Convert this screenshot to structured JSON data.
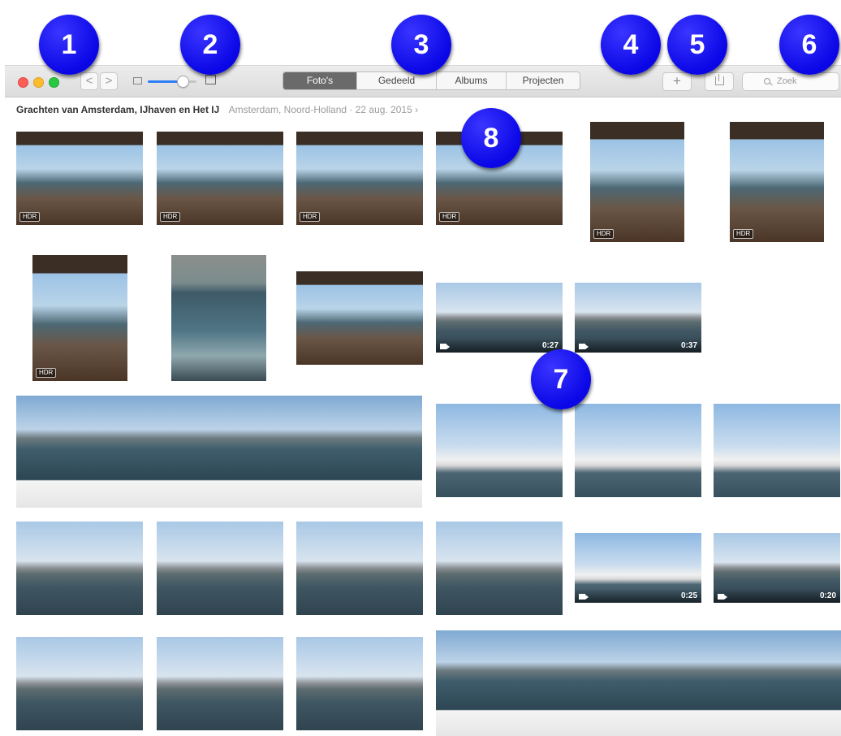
{
  "window": {
    "buttons": [
      "close",
      "minimize",
      "zoom"
    ]
  },
  "nav": {
    "back_label": "<",
    "forward_label": ">"
  },
  "zoom_slider": {
    "level": 0.7
  },
  "tabs": [
    {
      "label": "Foto's",
      "active": true
    },
    {
      "label": "Gedeeld",
      "active": false
    },
    {
      "label": "Albums",
      "active": false
    },
    {
      "label": "Projecten",
      "active": false
    }
  ],
  "toolbar": {
    "add_label": "+",
    "share_icon": "share-icon"
  },
  "search": {
    "placeholder": "Zoek"
  },
  "moment": {
    "title": "Grachten van Amsterdam, IJhaven en Het IJ",
    "meta": "Amsterdam, Noord-Holland · 22 aug. 2015 ›"
  },
  "callouts": [
    "1",
    "2",
    "3",
    "4",
    "5",
    "6",
    "7",
    "8"
  ],
  "photos": [
    {
      "scene": "cabin",
      "badge": "HDR"
    },
    {
      "scene": "cabin",
      "badge": "HDR"
    },
    {
      "scene": "cabin",
      "badge": "HDR"
    },
    {
      "scene": "cabin",
      "badge": "HDR"
    },
    {
      "scene": "cabin",
      "badge": "HDR"
    },
    {
      "scene": "cabin",
      "badge": "HDR"
    },
    {
      "scene": "cabin",
      "badge": "HDR"
    },
    {
      "scene": "wake"
    },
    {
      "scene": "cabin"
    },
    {
      "scene": "harbor",
      "duration": "0:27"
    },
    {
      "scene": "harbor",
      "duration": "0:37"
    },
    {
      "scene": "panorama"
    },
    {
      "scene": "tallship"
    },
    {
      "scene": "tallship"
    },
    {
      "scene": "tallship"
    },
    {
      "scene": "harbor"
    },
    {
      "scene": "harbor"
    },
    {
      "scene": "harbor"
    },
    {
      "scene": "harbor"
    },
    {
      "scene": "tallship",
      "duration": "0:25"
    },
    {
      "scene": "harbor",
      "duration": "0:20"
    },
    {
      "scene": "harbor"
    },
    {
      "scene": "harbor"
    },
    {
      "scene": "harbor"
    },
    {
      "scene": "panorama"
    }
  ],
  "colors": {
    "sky": "#9cc3e6",
    "water": "#3f5f6e",
    "cabin": "#5a4638",
    "accent": "#2f7ff6",
    "callout": "#0a06e6"
  }
}
